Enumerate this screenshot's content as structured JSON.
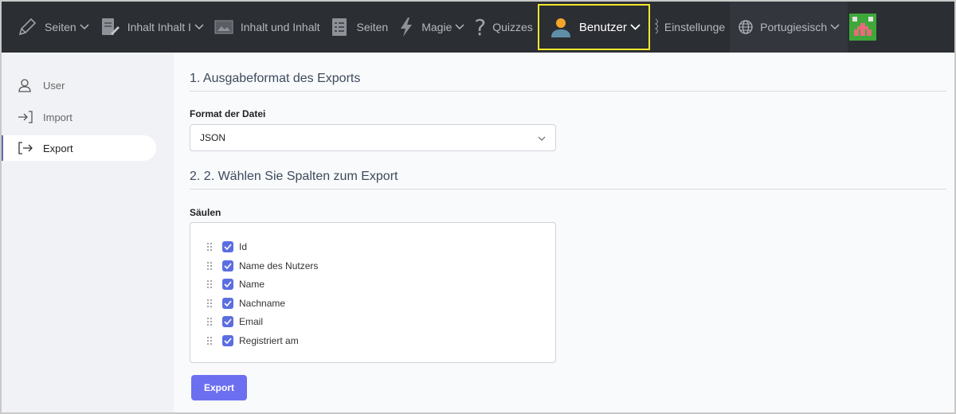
{
  "topbar": {
    "items": [
      {
        "label": "Seiten",
        "icon": "pencil-icon",
        "has_dropdown": true
      },
      {
        "label": "Inhalt Inhalt I",
        "icon": "document-edit-icon",
        "has_dropdown": true
      },
      {
        "label": "Inhalt und Inhalt",
        "icon": "image-icon",
        "has_dropdown": false
      },
      {
        "label": "Seiten",
        "icon": "list-page-icon",
        "has_dropdown": false
      },
      {
        "label": "Magie",
        "icon": "lightning-icon",
        "has_dropdown": true
      },
      {
        "label": "Quizzes",
        "icon": "question-icon",
        "has_dropdown": false
      },
      {
        "label": "Benutzer",
        "icon": "user-icon",
        "has_dropdown": true,
        "active": true
      },
      {
        "label": "Einstellunge",
        "icon": "settings-icon",
        "has_dropdown": false
      },
      {
        "label": "Portugiesisch",
        "icon": "globe-icon",
        "has_dropdown": true
      }
    ],
    "highlight_color": "#f1e62b"
  },
  "sidebar": {
    "items": [
      {
        "label": "User",
        "icon": "user-outline-icon"
      },
      {
        "label": "Import",
        "icon": "import-icon"
      },
      {
        "label": "Export",
        "icon": "export-icon",
        "active": true
      }
    ]
  },
  "main": {
    "section1_title": "1. Ausgabeformat des Exports",
    "format_label": "Format der Datei",
    "format_value": "JSON",
    "section2_title": "2. 2. Wählen Sie Spalten zum Export",
    "columns_label": "Säulen",
    "columns": [
      {
        "label": "Id",
        "checked": true
      },
      {
        "label": "Name des Nutzers",
        "checked": true
      },
      {
        "label": "Name",
        "checked": true
      },
      {
        "label": "Nachname",
        "checked": true
      },
      {
        "label": "Email",
        "checked": true
      },
      {
        "label": "Registriert am",
        "checked": true
      }
    ],
    "export_button": "Export",
    "accent_color": "#6c6ff0"
  }
}
